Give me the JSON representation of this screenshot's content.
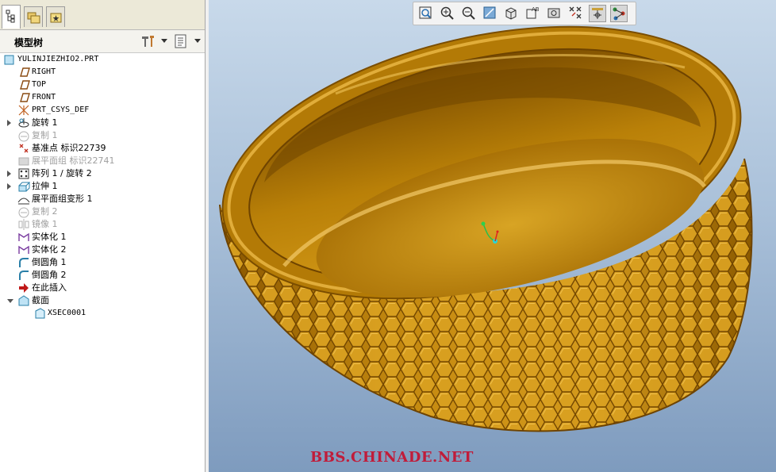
{
  "model_tree": {
    "title": "模型树",
    "items": [
      {
        "label": "YULINJIEZHIO2.PRT",
        "icon": "part-icon",
        "gray": false,
        "mono": true
      },
      {
        "label": "RIGHT",
        "icon": "datum-plane-icon",
        "gray": false,
        "mono": true
      },
      {
        "label": "TOP",
        "icon": "datum-plane-icon",
        "gray": false,
        "mono": true
      },
      {
        "label": "FRONT",
        "icon": "datum-plane-icon",
        "gray": false,
        "mono": true
      },
      {
        "label": "PRT_CSYS_DEF",
        "icon": "coordinate-system-icon",
        "gray": false,
        "mono": true
      },
      {
        "label": "旋转 1",
        "icon": "revolve-icon",
        "gray": false,
        "mono": false
      },
      {
        "label": "复制 1",
        "icon": "copy-icon",
        "gray": true,
        "mono": false
      },
      {
        "label": "基准点 标识22739",
        "icon": "datum-point-icon",
        "gray": false,
        "mono": false
      },
      {
        "label": "展平面组 标识22741",
        "icon": "flatten-quilt-icon",
        "gray": true,
        "mono": false
      },
      {
        "label": "阵列 1 / 旋转 2",
        "icon": "pattern-icon",
        "gray": false,
        "mono": false
      },
      {
        "label": "拉伸 1",
        "icon": "extrude-icon",
        "gray": false,
        "mono": false
      },
      {
        "label": "展平面组变形 1",
        "icon": "flatten-deform-icon",
        "gray": false,
        "mono": false
      },
      {
        "label": "复制 2",
        "icon": "copy-icon",
        "gray": true,
        "mono": false
      },
      {
        "label": "镜像 1",
        "icon": "mirror-icon",
        "gray": true,
        "mono": false
      },
      {
        "label": "实体化 1",
        "icon": "solidify-icon",
        "gray": false,
        "mono": false
      },
      {
        "label": "实体化 2",
        "icon": "solidify-icon",
        "gray": false,
        "mono": false
      },
      {
        "label": "倒圆角 1",
        "icon": "round-icon",
        "gray": false,
        "mono": false
      },
      {
        "label": "倒圆角 2",
        "icon": "round-icon",
        "gray": false,
        "mono": false
      },
      {
        "label": "在此插入",
        "icon": "insert-here-arrow-icon",
        "gray": false,
        "mono": false
      },
      {
        "label": "截面",
        "icon": "section-folder-icon",
        "gray": false,
        "mono": false
      },
      {
        "label": "XSEC0001",
        "icon": "section-icon",
        "gray": false,
        "mono": true
      }
    ]
  },
  "toolbar": {
    "buttons": [
      "refit-icon",
      "zoom-in-icon",
      "zoom-out-icon",
      "repaint-icon",
      "display-style-icon",
      "saved-views-icon",
      "view-manager-icon",
      "datum-display-icon",
      "spin-center-icon",
      "annotation-icon"
    ]
  },
  "watermark": "BBS.CHINADE.NET",
  "colors": {
    "model_gold": "#c8860a",
    "model_dark": "#7a4d00",
    "background_top": "#c8d9ea",
    "background_bottom": "#7e9bbe",
    "watermark": "#c01c3a"
  }
}
